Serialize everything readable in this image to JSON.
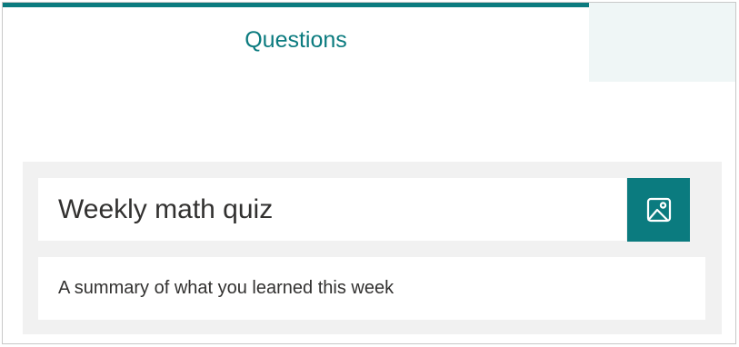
{
  "tabs": {
    "active_label": "Questions",
    "inactive_label": ""
  },
  "form": {
    "title": "Weekly math quiz",
    "description": "A summary of what you learned this week",
    "image_button_icon": "insert-image-icon"
  },
  "colors": {
    "accent": "#0b7b7f",
    "inactive_tab_bg": "#eff6f6",
    "card_bg": "#f1f1f1"
  }
}
